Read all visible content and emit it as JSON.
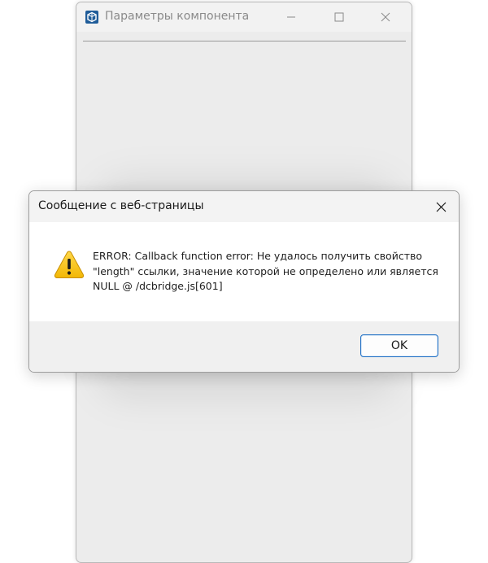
{
  "background_window": {
    "title": "Параметры компонента",
    "app_icon": "sketchup-icon",
    "controls": {
      "minimize_icon": "minimize-icon",
      "maximize_icon": "maximize-icon",
      "close_icon": "close-icon"
    }
  },
  "dialog": {
    "title": "Сообщение с веб-страницы",
    "close_icon": "close-icon",
    "warning_icon": "warning-icon",
    "message": "ERROR: Callback function error: Не удалось получить свойство \"length\" ссылки, значение которой не определено или является NULL @ /dcbridge.js[601]",
    "ok_label": "OK"
  },
  "colors": {
    "warning_fill": "#f4c20d",
    "accent_border": "#1f6fc4",
    "app_icon_blue": "#1f5c99"
  }
}
